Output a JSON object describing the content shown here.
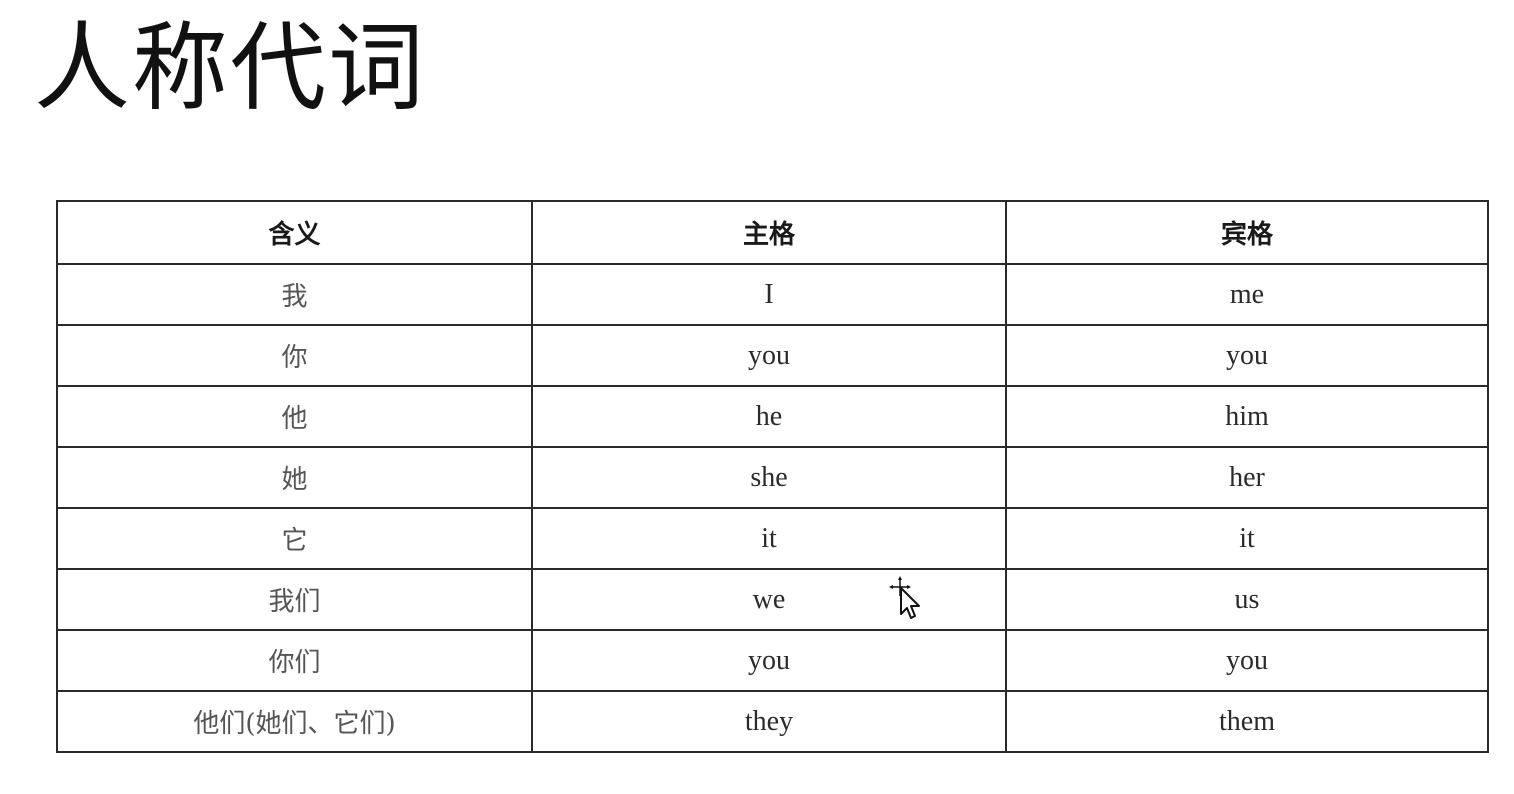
{
  "title": "人称代词",
  "table": {
    "headers": [
      "含义",
      "主格",
      "宾格"
    ],
    "rows": [
      {
        "meaning": "我",
        "subject": "I",
        "object": "me"
      },
      {
        "meaning": "你",
        "subject": "you",
        "object": "you"
      },
      {
        "meaning": "他",
        "subject": "he",
        "object": "him"
      },
      {
        "meaning": "她",
        "subject": "she",
        "object": "her"
      },
      {
        "meaning": "它",
        "subject": "it",
        "object": "it"
      },
      {
        "meaning": "我们",
        "subject": "we",
        "object": "us"
      },
      {
        "meaning": "你们",
        "subject": "you",
        "object": "you"
      },
      {
        "meaning": "他们(她们、它们)",
        "subject": "they",
        "object": "them"
      }
    ]
  },
  "cursor": {
    "icon": "move-cursor-icon"
  }
}
